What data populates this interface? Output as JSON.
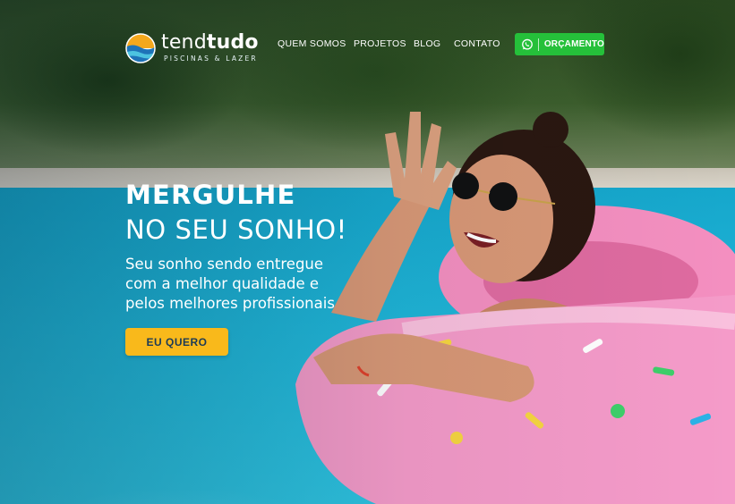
{
  "brand": {
    "name_light": "tend",
    "name_bold": "tudo",
    "tagline": "PISCINAS & LAZER",
    "logo_colors": [
      "#f4a81d",
      "#1e73b8",
      "#4cc3e0"
    ]
  },
  "nav": {
    "links": [
      {
        "label": "QUEM SOMOS"
      },
      {
        "label": "PROJETOS"
      },
      {
        "label": "BLOG"
      },
      {
        "label": "CONTATO"
      }
    ],
    "cta": {
      "label": "ORÇAMENTO",
      "icon": "whatsapp-icon",
      "color": "#25c03a"
    }
  },
  "hero": {
    "title_bold": "MERGULHE",
    "title_regular": "NO SEU SONHO!",
    "subtitle_lines": [
      "Seu sonho sendo entregue",
      "com a melhor qualidade e",
      "pelos melhores profissionais"
    ],
    "button": {
      "label": "EU QUERO",
      "color": "#f9b91b"
    },
    "photo_subject": "woman-in-pool-with-donut-float"
  }
}
